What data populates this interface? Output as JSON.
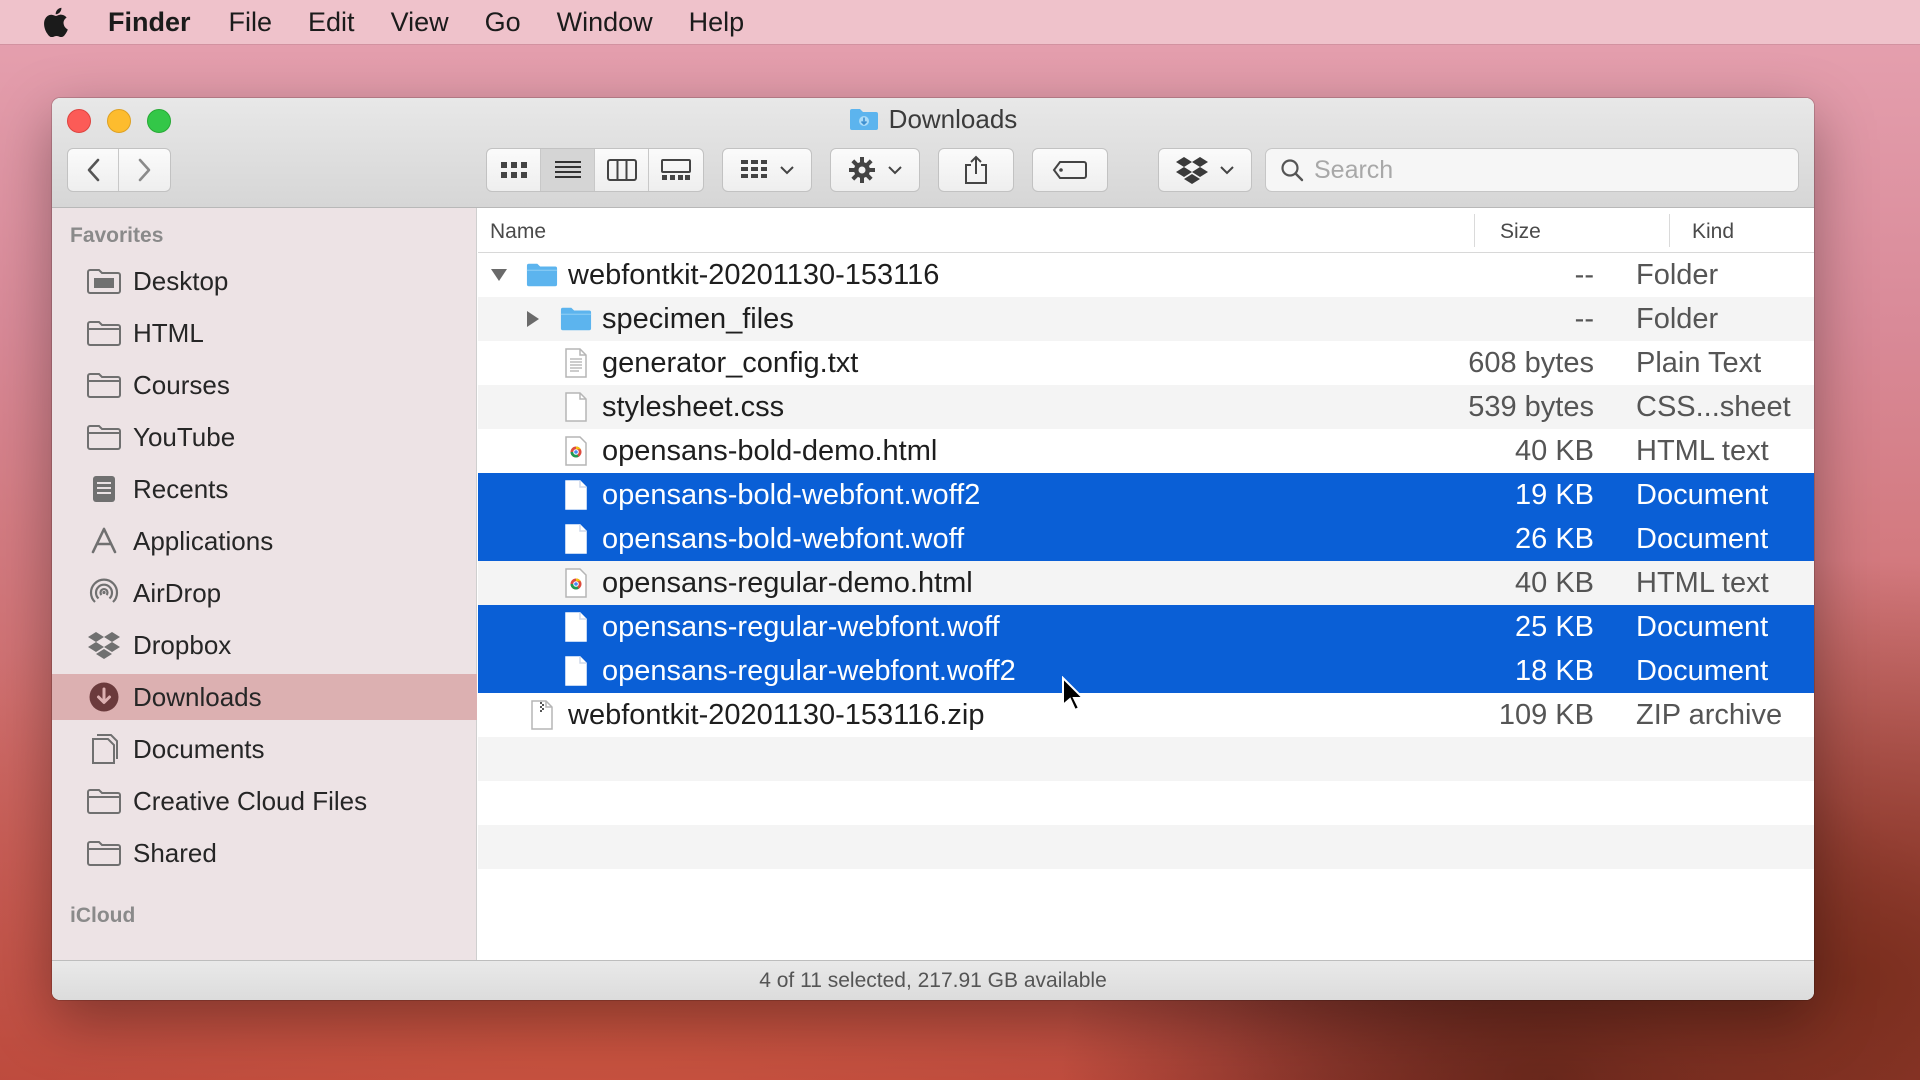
{
  "menubar": {
    "app_name": "Finder",
    "items": [
      "File",
      "Edit",
      "View",
      "Go",
      "Window",
      "Help"
    ]
  },
  "window": {
    "title": "Downloads",
    "search_placeholder": "Search"
  },
  "sidebar": {
    "favorites_heading": "Favorites",
    "items": [
      {
        "label": "Desktop",
        "icon": "desktop-folder-icon"
      },
      {
        "label": "HTML",
        "icon": "folder-icon"
      },
      {
        "label": "Courses",
        "icon": "folder-icon"
      },
      {
        "label": "YouTube",
        "icon": "folder-icon"
      },
      {
        "label": "Recents",
        "icon": "recents-icon"
      },
      {
        "label": "Applications",
        "icon": "applications-icon"
      },
      {
        "label": "AirDrop",
        "icon": "airdrop-icon"
      },
      {
        "label": "Dropbox",
        "icon": "dropbox-icon"
      },
      {
        "label": "Downloads",
        "icon": "downloads-icon",
        "selected": true
      },
      {
        "label": "Documents",
        "icon": "documents-icon"
      },
      {
        "label": "Creative Cloud Files",
        "icon": "folder-icon"
      },
      {
        "label": "Shared",
        "icon": "folder-icon"
      }
    ],
    "icloud_heading": "iCloud"
  },
  "columns": {
    "name": "Name",
    "size": "Size",
    "kind": "Kind"
  },
  "files": [
    {
      "name": "webfontkit-20201130-153116",
      "size": "--",
      "kind": "Folder",
      "type": "folder",
      "level": 0,
      "disclosure": "open",
      "selected": false
    },
    {
      "name": "specimen_files",
      "size": "--",
      "kind": "Folder",
      "type": "folder",
      "level": 1,
      "disclosure": "closed",
      "selected": false
    },
    {
      "name": "generator_config.txt",
      "size": "608 bytes",
      "kind": "Plain Text",
      "type": "text",
      "level": 1,
      "selected": false
    },
    {
      "name": "stylesheet.css",
      "size": "539 bytes",
      "kind": "CSS...sheet",
      "type": "doc",
      "level": 1,
      "selected": false
    },
    {
      "name": "opensans-bold-demo.html",
      "size": "40 KB",
      "kind": "HTML text",
      "type": "html",
      "level": 1,
      "selected": false
    },
    {
      "name": "opensans-bold-webfont.woff2",
      "size": "19 KB",
      "kind": "Document",
      "type": "doc",
      "level": 1,
      "selected": true
    },
    {
      "name": "opensans-bold-webfont.woff",
      "size": "26 KB",
      "kind": "Document",
      "type": "doc",
      "level": 1,
      "selected": true
    },
    {
      "name": "opensans-regular-demo.html",
      "size": "40 KB",
      "kind": "HTML text",
      "type": "html",
      "level": 1,
      "selected": false
    },
    {
      "name": "opensans-regular-webfont.woff",
      "size": "25 KB",
      "kind": "Document",
      "type": "doc",
      "level": 1,
      "selected": true
    },
    {
      "name": "opensans-regular-webfont.woff2",
      "size": "18 KB",
      "kind": "Document",
      "type": "doc",
      "level": 1,
      "selected": true
    },
    {
      "name": "webfontkit-20201130-153116.zip",
      "size": "109 KB",
      "kind": "ZIP archive",
      "type": "zip",
      "level": 0,
      "selected": false
    }
  ],
  "status": "4 of 11 selected, 217.91 GB available",
  "colors": {
    "selection": "#0a5fd6",
    "sidebar_selected": "#dcb0b1",
    "folder_blue": "#5cb4ee"
  }
}
